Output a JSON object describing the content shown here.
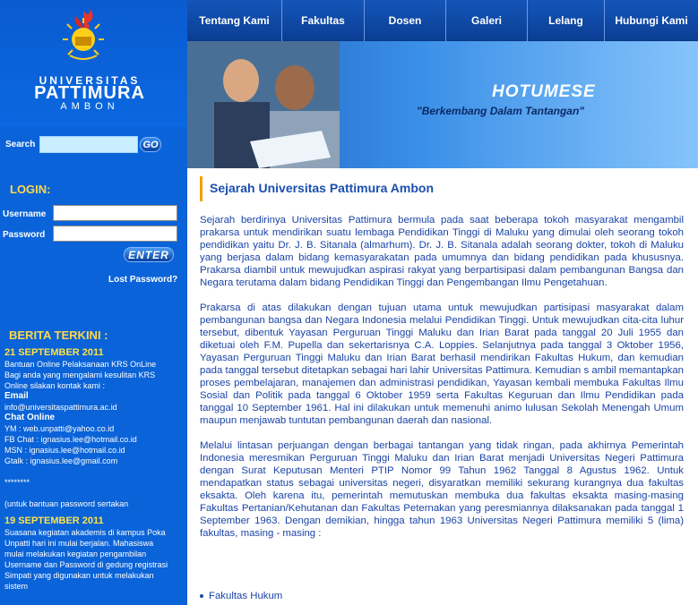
{
  "brand": {
    "line1": "UNIVERSITAS",
    "line2": "PATTIMURA",
    "line3": "AMBON"
  },
  "search": {
    "label": "Search",
    "button": "GO",
    "value": "",
    "placeholder": ""
  },
  "login": {
    "heading": "LOGIN:",
    "username_label": "Username",
    "password_label": "Password",
    "enter_label": "ENTER",
    "lost_password": "Lost Password?"
  },
  "news": {
    "heading": "BERITA TERKINI :",
    "item1": {
      "date": "21 SEPTEMBER 2011",
      "lines": [
        "Bantuan Online Pelaksanaan KRS OnLine",
        "Bagi anda yang mengalami kesulitan KRS",
        "Online silakan kontak kami :"
      ],
      "email_label": "Email",
      "email": "info@universitaspattimura.ac.id",
      "chat_label": "Chat Online",
      "contacts": [
        "YM : web.unpatti@yahoo.co.id",
        "FB Chat  : ignasius.lee@hotmail.co.id",
        "MSN : ignasius.lee@hotmail.co.id",
        "Gtalk : ignasius.lee@gmail.com"
      ],
      "separator": "********",
      "note": "(untuk bantuan password sertakan"
    },
    "item2": {
      "date": "19 SEPTEMBER 2011",
      "lines": [
        "Suasana kegiatan akademis di kampus Poka",
        "Unpatti hari ini mulai berjalan. Mahasiswa",
        "mulai melakukan kegiatan pengambilan",
        "Username dan Password di gedung registrasi",
        "Simpati yang digunakan untuk melakukan",
        "sistem"
      ]
    }
  },
  "nav": {
    "items": [
      "Tentang Kami",
      "Fakultas",
      "Dosen",
      "Galeri",
      "Lelang",
      "Hubungi Kami"
    ]
  },
  "banner": {
    "title": "HOTUMESE",
    "tagline": "\"Berkembang Dalam Tantangan\""
  },
  "content": {
    "title": "Sejarah Universitas Pattimura Ambon",
    "paragraphs": [
      "Sejarah berdirinya Universitas Pattimura bermula pada saat beberapa tokoh masyarakat mengambil prakarsa untuk mendirikan suatu lembaga Pendidikan Tinggi di Maluku yang dimulai oleh seorang tokoh pendidikan yaitu Dr. J. B. Sitanala (almarhum). Dr. J. B. Sitanala adalah seorang dokter, tokoh di Maluku yang berjasa dalam bidang kemasyarakatan pada umumnya dan bidang pendidikan pada khususnya. Prakarsa diambil untuk mewujudkan aspirasi rakyat yang berpartisipasi dalam pembangunan Bangsa dan Negara terutama dalam bidang Pendidikan Tinggi dan Pengembangan Ilmu Pengetahuan.",
      "Prakarsa di atas dilakukan dengan tujuan utama untuk mewujudkan partisipasi masyarakat dalam pembangunan bangsa dan Negara Indonesia melalui Pendidikan Tinggi. Untuk mewujudkan cita-cita luhur tersebut, dibentuk Yayasan Perguruan Tinggi Maluku dan Irian Barat pada tanggal 20 Juli 1955 dan diketuai oleh F.M. Pupella dan sekertarisnya C.A. Loppies. Selanjutnya pada tanggal 3 Oktober 1956, Yayasan Perguruan Tinggi Maluku dan Irian Barat berhasil mendirikan Fakultas Hukum, dan kemudian pada tanggal tersebut ditetapkan sebagai hari lahir Universitas Pattimura. Kemudian s ambil memantapkan proses pembelajaran, manajemen dan administrasi pendidikan, Yayasan kembali membuka Fakultas Ilmu Sosial dan Politik pada tanggal 6 Oktober 1959 serta Fakultas Keguruan dan Ilmu Pendidikan pada tanggal 10 September 1961. Hal ini dilakukan untuk memenuhi animo lulusan Sekolah Menengah Umum maupun menjawab tuntutan pembangunan daerah dan nasional.",
      "Melalui lintasan perjuangan dengan berbagai tantangan yang tidak ringan, pada akhirnya Pemerintah Indonesia meresmikan Perguruan Tinggi Maluku dan Irian Barat menjadi Universitas Negeri Pattimura dengan Surat Keputusan Menteri PTIP Nomor 99 Tahun 1962 Tanggal 8 Agustus 1962. Untuk mendapatkan status sebagai universitas negeri, disyaratkan memiliki sekurang kurangnya dua fakultas eksakta. Oleh karena itu, pemerintah memutuskan membuka dua fakultas eksakta masing-masing Fakultas Pertanian/Kehutanan dan Fakultas Peternakan yang peresmiannya dilaksanakan pada tanggal 1 September 1963. Dengan demikian, hingga tahun 1963 Universitas Negeri Pattimura memiliki 5 (lima) fakultas, masing - masing :"
    ],
    "faculties": [
      "Fakultas Hukum"
    ]
  }
}
